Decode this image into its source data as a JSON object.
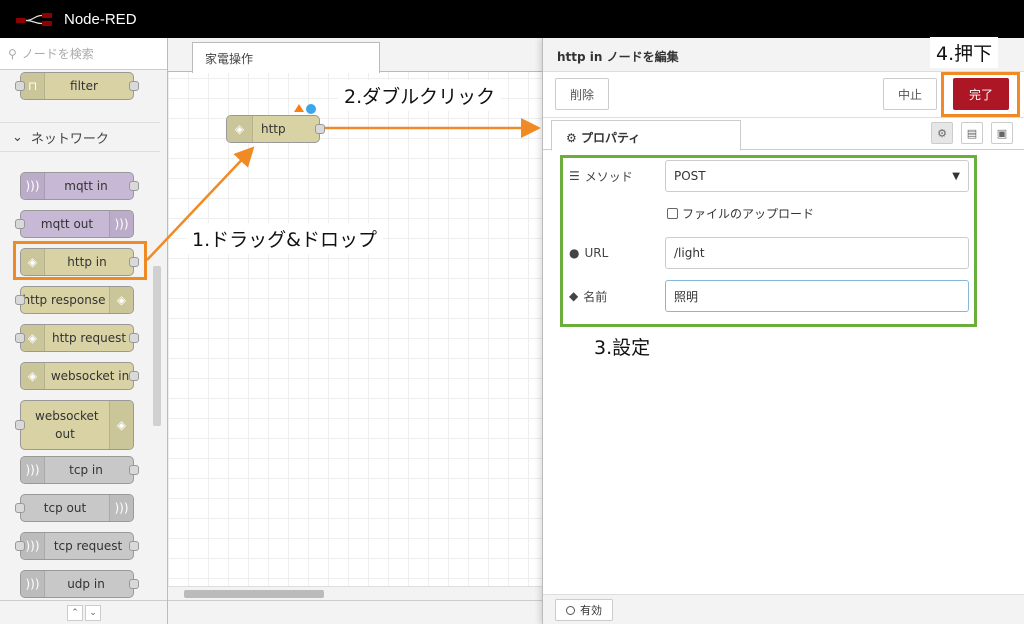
{
  "app": {
    "title": "Node-RED"
  },
  "palette": {
    "search_placeholder": "ノードを検索",
    "category": "ネットワーク",
    "top_node": "filter",
    "nodes": [
      "mqtt in",
      "mqtt out",
      "http in",
      "http response",
      "http request",
      "websocket in",
      "websocket out",
      "tcp in",
      "tcp out",
      "tcp request",
      "udp in"
    ]
  },
  "workspace": {
    "tab": "家電操作",
    "node_label": "http"
  },
  "editor": {
    "title": "http in ノードを編集",
    "delete_label": "削除",
    "cancel_label": "中止",
    "done_label": "完了",
    "tab_properties": "プロパティ",
    "method_label": "メソッド",
    "method_value": "POST",
    "upload_label": "ファイルのアップロード",
    "url_label": "URL",
    "url_value": "/light",
    "name_label": "名前",
    "name_value": "照明",
    "enabled_label": "有効"
  },
  "annotations": {
    "step1": "1.ドラッグ&ドロップ",
    "step2": "2.ダブルクリック",
    "step3": "3.設定",
    "step4": "4.押下"
  },
  "colors": {
    "accent_done": "#ad1625",
    "annotation_orange": "#f08a24",
    "annotation_green": "#6aaf3c",
    "node_http": "#d8d2a4",
    "node_mqtt": "#c7b8d6",
    "node_tcp": "#c8c8c8"
  }
}
